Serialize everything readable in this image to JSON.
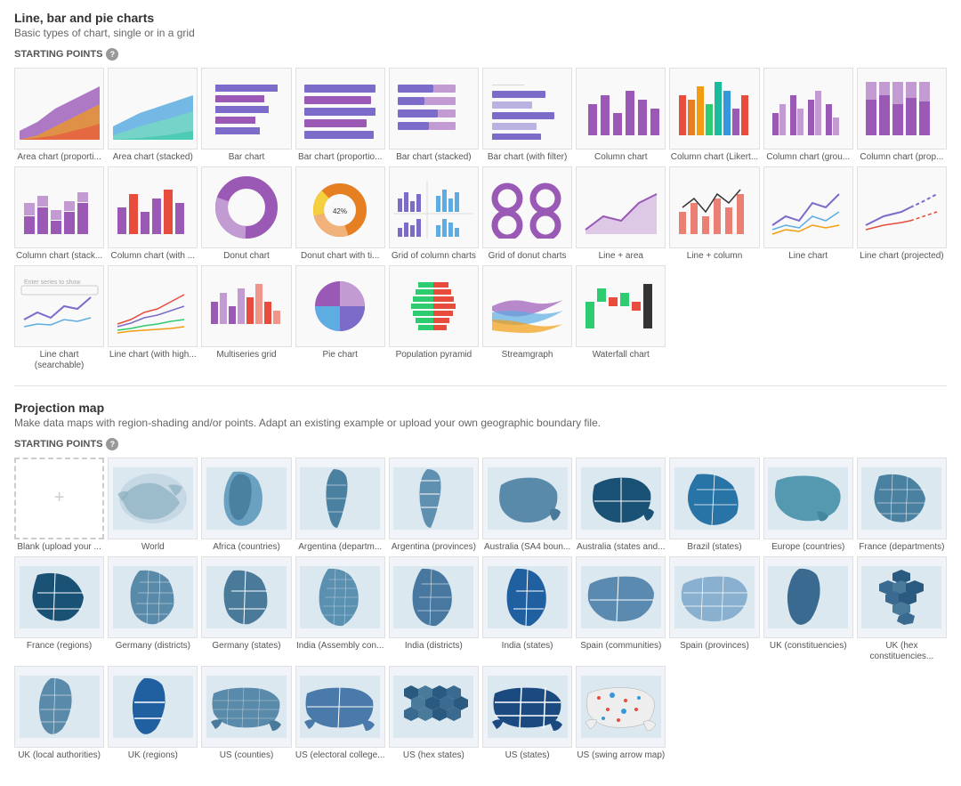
{
  "sections": [
    {
      "id": "charts",
      "title": "Line, bar and pie charts",
      "subtitle": "Basic types of chart, single or in a grid",
      "starting_points_label": "STARTING POINTS",
      "items": [
        {
          "id": "area-proportional",
          "label": "Area chart (proporti..."
        },
        {
          "id": "area-stacked",
          "label": "Area chart (stacked)"
        },
        {
          "id": "bar-chart",
          "label": "Bar chart"
        },
        {
          "id": "bar-proportional",
          "label": "Bar chart (proportio..."
        },
        {
          "id": "bar-stacked",
          "label": "Bar chart (stacked)"
        },
        {
          "id": "bar-filter",
          "label": "Bar chart (with filter)"
        },
        {
          "id": "column-chart",
          "label": "Column chart"
        },
        {
          "id": "column-likert",
          "label": "Column chart (Likert..."
        },
        {
          "id": "column-group",
          "label": "Column chart (grou..."
        },
        {
          "id": "column-prop",
          "label": "Column chart (prop..."
        },
        {
          "id": "column-stack",
          "label": "Column chart (stack..."
        },
        {
          "id": "column-with",
          "label": "Column chart (with ..."
        },
        {
          "id": "donut-chart",
          "label": "Donut chart"
        },
        {
          "id": "donut-title",
          "label": "Donut chart with ti..."
        },
        {
          "id": "grid-column",
          "label": "Grid of column charts"
        },
        {
          "id": "grid-donut",
          "label": "Grid of donut charts"
        },
        {
          "id": "line-area",
          "label": "Line + area"
        },
        {
          "id": "line-column",
          "label": "Line + column"
        },
        {
          "id": "line-chart",
          "label": "Line chart"
        },
        {
          "id": "line-projected",
          "label": "Line chart (projected)"
        },
        {
          "id": "line-searchable",
          "label": "Line chart (searchable)"
        },
        {
          "id": "line-high",
          "label": "Line chart (with high..."
        },
        {
          "id": "multiseries",
          "label": "Multiseries grid"
        },
        {
          "id": "pie-chart",
          "label": "Pie chart"
        },
        {
          "id": "population",
          "label": "Population pyramid"
        },
        {
          "id": "streamgraph",
          "label": "Streamgraph"
        },
        {
          "id": "waterfall",
          "label": "Waterfall chart"
        }
      ]
    },
    {
      "id": "maps",
      "title": "Projection map",
      "subtitle": "Make data maps with region-shading and/or points. Adapt an existing example or upload your own geographic boundary file.",
      "starting_points_label": "STARTING POINTS",
      "items": [
        {
          "id": "blank-upload",
          "label": "Blank (upload your ..."
        },
        {
          "id": "world",
          "label": "World"
        },
        {
          "id": "africa",
          "label": "Africa (countries)"
        },
        {
          "id": "argentina-dept",
          "label": "Argentina (departm..."
        },
        {
          "id": "argentina-prov",
          "label": "Argentina (provinces)"
        },
        {
          "id": "australia-sa4",
          "label": "Australia (SA4 boun..."
        },
        {
          "id": "australia-states",
          "label": "Australia (states and..."
        },
        {
          "id": "brazil-states",
          "label": "Brazil (states)"
        },
        {
          "id": "europe",
          "label": "Europe (countries)"
        },
        {
          "id": "france-dept",
          "label": "France (departments)"
        },
        {
          "id": "france-regions",
          "label": "France (regions)"
        },
        {
          "id": "germany-dist",
          "label": "Germany (districts)"
        },
        {
          "id": "germany-states",
          "label": "Germany (states)"
        },
        {
          "id": "india-assembly",
          "label": "India (Assembly con..."
        },
        {
          "id": "india-districts",
          "label": "India (districts)"
        },
        {
          "id": "india-states",
          "label": "India (states)"
        },
        {
          "id": "spain-communities",
          "label": "Spain (communities)"
        },
        {
          "id": "spain-provinces",
          "label": "Spain (provinces)"
        },
        {
          "id": "uk-const",
          "label": "UK (constituencies)"
        },
        {
          "id": "uk-hex-const",
          "label": "UK (hex constituencies..."
        },
        {
          "id": "uk-local",
          "label": "UK (local authorities)"
        },
        {
          "id": "uk-regions",
          "label": "UK (regions)"
        },
        {
          "id": "us-counties",
          "label": "US (counties)"
        },
        {
          "id": "us-electoral",
          "label": "US (electoral college..."
        },
        {
          "id": "us-hex",
          "label": "US (hex states)"
        },
        {
          "id": "us-states",
          "label": "US (states)"
        },
        {
          "id": "us-swing",
          "label": "US (swing arrow map)"
        }
      ]
    }
  ]
}
